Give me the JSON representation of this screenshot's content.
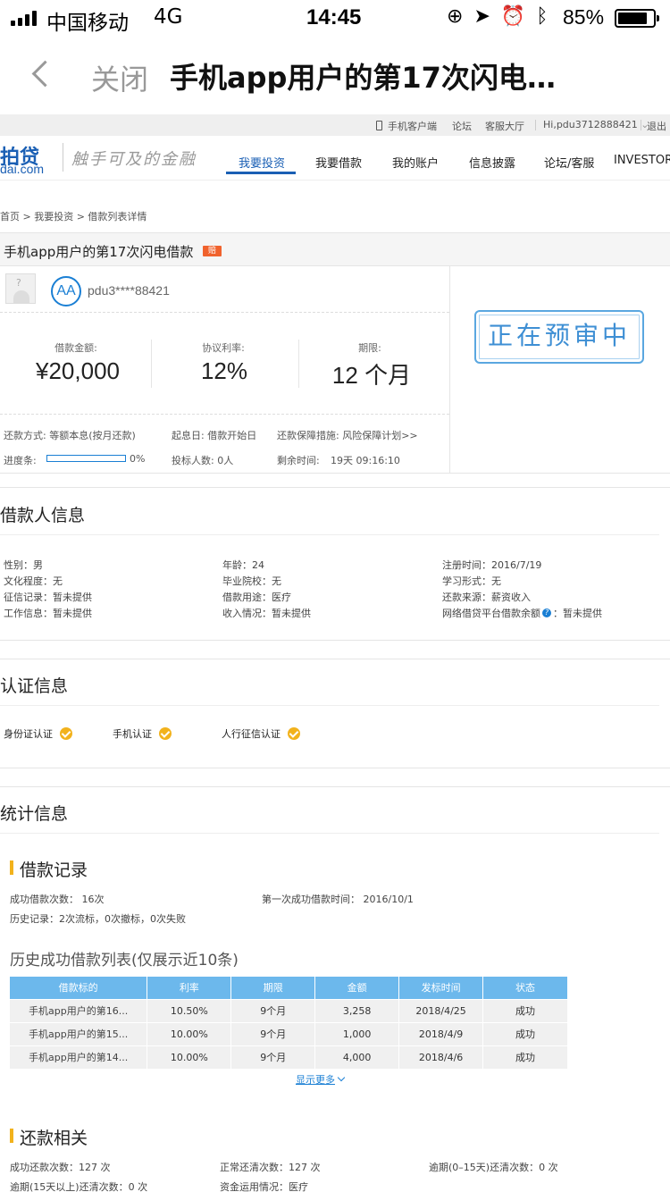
{
  "status_bar": {
    "carrier": "中国移动",
    "network": "4G",
    "time": "14:45",
    "battery": "85%",
    "battery_level": 0.85
  },
  "navbar": {
    "close_label": "关闭",
    "title": "手机app用户的第17次闪电…"
  },
  "util_bar": {
    "mobile_client": "手机客户端",
    "forum": "论坛",
    "service_hall": "客服大厅",
    "user_greeting": "Hi,pdu3712888421",
    "logout": "退出"
  },
  "site_header": {
    "logo_main": "拍贷",
    "logo_sub": "dai.com",
    "slogan": "触手可及的金融",
    "nav": [
      "我要投资",
      "我要借款",
      "我的账户",
      "信息披露",
      "论坛/客服",
      "INVESTOR"
    ],
    "active_nav": "我要投资"
  },
  "breadcrumb": "首页 > 我要投资 > 借款列表详情",
  "loan": {
    "title": "手机app用户的第17次闪电借款",
    "badge": "赔",
    "credit_grade": "AA",
    "username": "pdu3****88421",
    "amount_label": "借款金额:",
    "amount": "¥20,000",
    "rate_label": "协议利率:",
    "rate": "12%",
    "term_label": "期限:",
    "term": "12 个月",
    "repay_method": "还款方式: 等额本息(按月还款)",
    "start_date": "起息日: 借款开始日",
    "guarantee": "还款保障措施: 风险保障计划>>",
    "progress_label": "进度条:",
    "progress_pct": "0%",
    "progress_value": 0,
    "bidders": "投标人数: 0人",
    "remaining_label": "剩余时间:",
    "remaining": "19天 09:16:10",
    "status_stamp": "正在预审中"
  },
  "borrower": {
    "section_title": "借款人信息",
    "col1": [
      "性别：男",
      "文化程度：无",
      "征信记录：暂未提供",
      "工作信息：暂未提供"
    ],
    "col2": [
      "年龄：24",
      "毕业院校：无",
      "借款用途：医疗",
      "收入情况：暂未提供"
    ],
    "col3": [
      "注册时间：2016/7/19",
      "学习形式：无",
      "还款来源：薪资收入"
    ],
    "online_debt_label": "网络借贷平台借款余额",
    "online_debt_value": "：暂未提供"
  },
  "auth": {
    "section_title": "认证信息",
    "items": [
      "身份证认证",
      "手机认证",
      "人行征信认证"
    ]
  },
  "stats": {
    "section_title": "统计信息",
    "loan_record_title": "借款记录",
    "success_count": "成功借款次数： 16次",
    "first_success": "第一次成功借款时间： 2016/10/1",
    "history": "历史记录：2次流标，0次撤标，0次失败",
    "history_list_title": "历史成功借款列表(仅展示近10条)",
    "table_headers": [
      "借款标的",
      "利率",
      "期限",
      "金额",
      "发标时间",
      "状态"
    ],
    "table_rows": [
      [
        "手机app用户的第16...",
        "10.50%",
        "9个月",
        "3,258",
        "2018/4/25",
        "成功"
      ],
      [
        "手机app用户的第15...",
        "10.00%",
        "9个月",
        "1,000",
        "2018/4/9",
        "成功"
      ],
      [
        "手机app用户的第14...",
        "10.00%",
        "9个月",
        "4,000",
        "2018/4/6",
        "成功"
      ]
    ],
    "show_more": "显示更多",
    "repay_title": "还款相关",
    "repay_success": "成功还款次数：127 次",
    "repay_normal": "正常还清次数：127 次",
    "repay_overdue_short": "逾期(0–15天)还清次数：0 次",
    "repay_overdue_long": "逾期(15天以上)还清次数：0 次",
    "fund_usage": "资金运用情况：医疗"
  }
}
